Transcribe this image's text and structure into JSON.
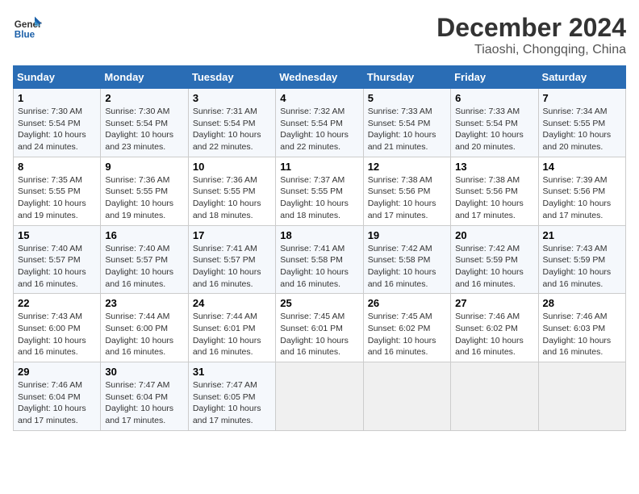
{
  "logo": {
    "line1": "General",
    "line2": "Blue"
  },
  "title": "December 2024",
  "subtitle": "Tiaoshi, Chongqing, China",
  "weekdays": [
    "Sunday",
    "Monday",
    "Tuesday",
    "Wednesday",
    "Thursday",
    "Friday",
    "Saturday"
  ],
  "weeks": [
    [
      {
        "day": "1",
        "sunrise": "7:30 AM",
        "sunset": "5:54 PM",
        "daylight": "10 hours and 24 minutes."
      },
      {
        "day": "2",
        "sunrise": "7:30 AM",
        "sunset": "5:54 PM",
        "daylight": "10 hours and 23 minutes."
      },
      {
        "day": "3",
        "sunrise": "7:31 AM",
        "sunset": "5:54 PM",
        "daylight": "10 hours and 22 minutes."
      },
      {
        "day": "4",
        "sunrise": "7:32 AM",
        "sunset": "5:54 PM",
        "daylight": "10 hours and 22 minutes."
      },
      {
        "day": "5",
        "sunrise": "7:33 AM",
        "sunset": "5:54 PM",
        "daylight": "10 hours and 21 minutes."
      },
      {
        "day": "6",
        "sunrise": "7:33 AM",
        "sunset": "5:54 PM",
        "daylight": "10 hours and 20 minutes."
      },
      {
        "day": "7",
        "sunrise": "7:34 AM",
        "sunset": "5:55 PM",
        "daylight": "10 hours and 20 minutes."
      }
    ],
    [
      {
        "day": "8",
        "sunrise": "7:35 AM",
        "sunset": "5:55 PM",
        "daylight": "10 hours and 19 minutes."
      },
      {
        "day": "9",
        "sunrise": "7:36 AM",
        "sunset": "5:55 PM",
        "daylight": "10 hours and 19 minutes."
      },
      {
        "day": "10",
        "sunrise": "7:36 AM",
        "sunset": "5:55 PM",
        "daylight": "10 hours and 18 minutes."
      },
      {
        "day": "11",
        "sunrise": "7:37 AM",
        "sunset": "5:55 PM",
        "daylight": "10 hours and 18 minutes."
      },
      {
        "day": "12",
        "sunrise": "7:38 AM",
        "sunset": "5:56 PM",
        "daylight": "10 hours and 17 minutes."
      },
      {
        "day": "13",
        "sunrise": "7:38 AM",
        "sunset": "5:56 PM",
        "daylight": "10 hours and 17 minutes."
      },
      {
        "day": "14",
        "sunrise": "7:39 AM",
        "sunset": "5:56 PM",
        "daylight": "10 hours and 17 minutes."
      }
    ],
    [
      {
        "day": "15",
        "sunrise": "7:40 AM",
        "sunset": "5:57 PM",
        "daylight": "10 hours and 16 minutes."
      },
      {
        "day": "16",
        "sunrise": "7:40 AM",
        "sunset": "5:57 PM",
        "daylight": "10 hours and 16 minutes."
      },
      {
        "day": "17",
        "sunrise": "7:41 AM",
        "sunset": "5:57 PM",
        "daylight": "10 hours and 16 minutes."
      },
      {
        "day": "18",
        "sunrise": "7:41 AM",
        "sunset": "5:58 PM",
        "daylight": "10 hours and 16 minutes."
      },
      {
        "day": "19",
        "sunrise": "7:42 AM",
        "sunset": "5:58 PM",
        "daylight": "10 hours and 16 minutes."
      },
      {
        "day": "20",
        "sunrise": "7:42 AM",
        "sunset": "5:59 PM",
        "daylight": "10 hours and 16 minutes."
      },
      {
        "day": "21",
        "sunrise": "7:43 AM",
        "sunset": "5:59 PM",
        "daylight": "10 hours and 16 minutes."
      }
    ],
    [
      {
        "day": "22",
        "sunrise": "7:43 AM",
        "sunset": "6:00 PM",
        "daylight": "10 hours and 16 minutes."
      },
      {
        "day": "23",
        "sunrise": "7:44 AM",
        "sunset": "6:00 PM",
        "daylight": "10 hours and 16 minutes."
      },
      {
        "day": "24",
        "sunrise": "7:44 AM",
        "sunset": "6:01 PM",
        "daylight": "10 hours and 16 minutes."
      },
      {
        "day": "25",
        "sunrise": "7:45 AM",
        "sunset": "6:01 PM",
        "daylight": "10 hours and 16 minutes."
      },
      {
        "day": "26",
        "sunrise": "7:45 AM",
        "sunset": "6:02 PM",
        "daylight": "10 hours and 16 minutes."
      },
      {
        "day": "27",
        "sunrise": "7:46 AM",
        "sunset": "6:02 PM",
        "daylight": "10 hours and 16 minutes."
      },
      {
        "day": "28",
        "sunrise": "7:46 AM",
        "sunset": "6:03 PM",
        "daylight": "10 hours and 16 minutes."
      }
    ],
    [
      {
        "day": "29",
        "sunrise": "7:46 AM",
        "sunset": "6:04 PM",
        "daylight": "10 hours and 17 minutes."
      },
      {
        "day": "30",
        "sunrise": "7:47 AM",
        "sunset": "6:04 PM",
        "daylight": "10 hours and 17 minutes."
      },
      {
        "day": "31",
        "sunrise": "7:47 AM",
        "sunset": "6:05 PM",
        "daylight": "10 hours and 17 minutes."
      },
      null,
      null,
      null,
      null
    ]
  ],
  "labels": {
    "sunrise": "Sunrise:",
    "sunset": "Sunset:",
    "daylight": "Daylight:"
  }
}
